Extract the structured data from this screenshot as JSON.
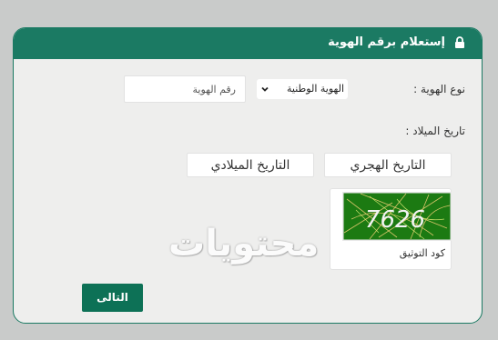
{
  "header": {
    "title": "إستعلام برقم الهوية",
    "icon": "lock-icon",
    "background": "#1b7a63"
  },
  "form": {
    "id_type_label": "نوع الهوية :",
    "id_type_selected": "الهوية الوطنية",
    "id_number_placeholder": "رقم الهوية",
    "birth_date_label": "تاريخ الميلاد :",
    "hijri_label": "التاريخ الهجري",
    "gregorian_label": "التاريخ الميلادي",
    "captcha_value": "7626",
    "captcha_label": "كود التوثيق",
    "next_label": "التالى"
  },
  "watermark": "محتويات",
  "colors": {
    "primary": "#1b7a63",
    "button": "#0d7156",
    "captcha_bg": "#1c7a12"
  }
}
